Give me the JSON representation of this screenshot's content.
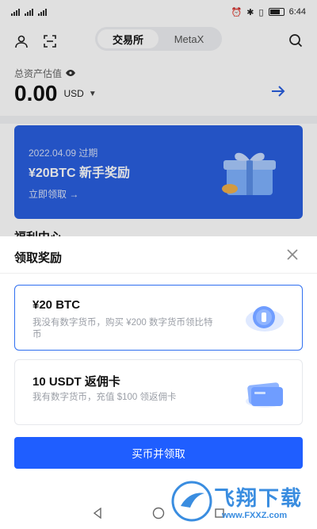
{
  "status_bar": {
    "time": "6:44"
  },
  "nav": {
    "tabs": [
      {
        "label": "交易所",
        "active": true
      },
      {
        "label": "MetaX",
        "active": false
      }
    ]
  },
  "asset": {
    "label": "总资产估值",
    "value": "0.00",
    "currency": "USD"
  },
  "banner": {
    "date": "2022.04.09 过期",
    "title": "¥20BTC 新手奖励",
    "cta": "立即领取 →"
  },
  "section_peek": "福利中心",
  "sheet": {
    "title": "领取奖励",
    "options": [
      {
        "title": "¥20 BTC",
        "desc": "我没有数字货币，购买 ¥200 数字货币领比特币",
        "selected": true
      },
      {
        "title": "10 USDT 返佣卡",
        "desc": "我有数字货币，充值 $100 领返佣卡",
        "selected": false
      }
    ],
    "button_label": "买币并领取"
  },
  "watermark": {
    "brand": "飞翔下载",
    "url": "www.FXXZ.com"
  },
  "colors": {
    "primary": "#1f5eff",
    "banner": "#2a5fe0",
    "selected_border": "#2f6ff0"
  }
}
